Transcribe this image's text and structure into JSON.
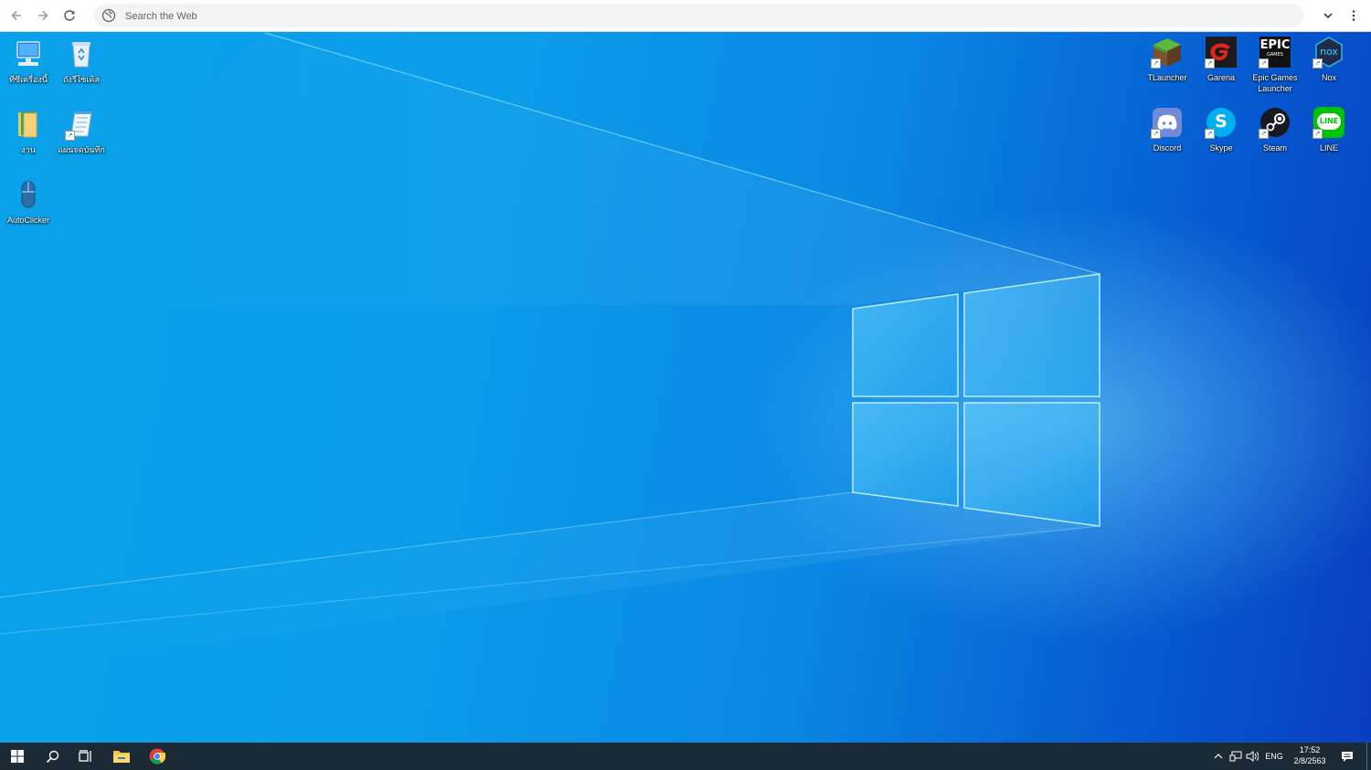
{
  "browser": {
    "search_placeholder": "Search the Web"
  },
  "desktop": {
    "left_icons": [
      {
        "label": "ทีซีเครื่องนี้",
        "icon": "computer-icon"
      },
      {
        "label": "ถังรีไซเคิล",
        "icon": "recycle-bin-icon"
      },
      {
        "label": "งาน",
        "icon": "folder-icon"
      },
      {
        "label": "แผ่นจดบันทึก",
        "icon": "notepad-icon"
      },
      {
        "label": "AutoClicker",
        "icon": "mouse-icon"
      }
    ],
    "right_icons": [
      {
        "label": "TLauncher",
        "icon": "tlauncher-icon"
      },
      {
        "label": "Garena",
        "icon": "garena-icon"
      },
      {
        "label": "Epic Games Launcher",
        "icon": "epic-games-icon",
        "badge_text": "EPIC",
        "badge_sub": "GAMES"
      },
      {
        "label": "Nox",
        "icon": "nox-icon",
        "badge_text": "nox"
      },
      {
        "label": "Discord",
        "icon": "discord-icon"
      },
      {
        "label": "Skype",
        "icon": "skype-icon",
        "badge_text": "S"
      },
      {
        "label": "Steam",
        "icon": "steam-icon"
      },
      {
        "label": "LINE",
        "icon": "line-icon",
        "badge_text": "LINE"
      }
    ]
  },
  "taskbar": {
    "language": "ENG",
    "time": "17:52",
    "date": "2/8/2563",
    "pinned": [
      "start-icon",
      "search-icon",
      "task-view-icon",
      "file-explorer-icon",
      "chrome-icon"
    ]
  },
  "colors": {
    "wallpaper_blue": "#0a9ce9",
    "taskbar": "#1c2a35",
    "accent": "#4ac8ff"
  }
}
